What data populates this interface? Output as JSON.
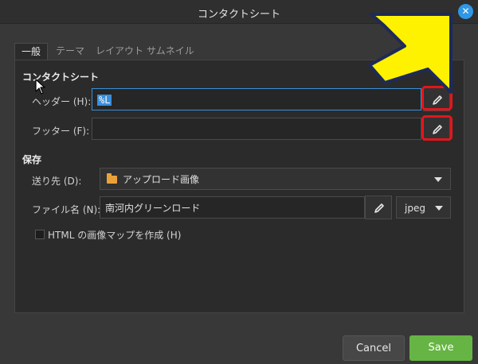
{
  "window": {
    "title": "コンタクトシート",
    "close_icon": "close-icon"
  },
  "tabs": [
    {
      "label": "一般",
      "active": true
    },
    {
      "label": "テーマ",
      "active": false
    },
    {
      "label": "レイアウト",
      "active": false
    },
    {
      "label": "サムネイル",
      "active": false
    }
  ],
  "contact_sheet": {
    "section_title": "コンタクトシート",
    "header_label": "ヘッダー (H):",
    "header_value": "%L",
    "footer_label": "フッター (F):",
    "footer_value": ""
  },
  "save": {
    "section_title": "保存",
    "destination_label": "送り先 (D):",
    "destination_value": "アップロード画像",
    "filename_label": "ファイル名 (N):",
    "filename_value": "南河内グリーンロード",
    "format_value": "jpeg",
    "imagemap_label": "HTML の画像マップを作成 (H)",
    "imagemap_checked": false
  },
  "buttons": {
    "cancel": "Cancel",
    "save": "Save"
  },
  "colors": {
    "accent": "#3a8fdb",
    "save_button": "#66b544",
    "highlight": "#e4151b",
    "arrow": "#fff200"
  }
}
